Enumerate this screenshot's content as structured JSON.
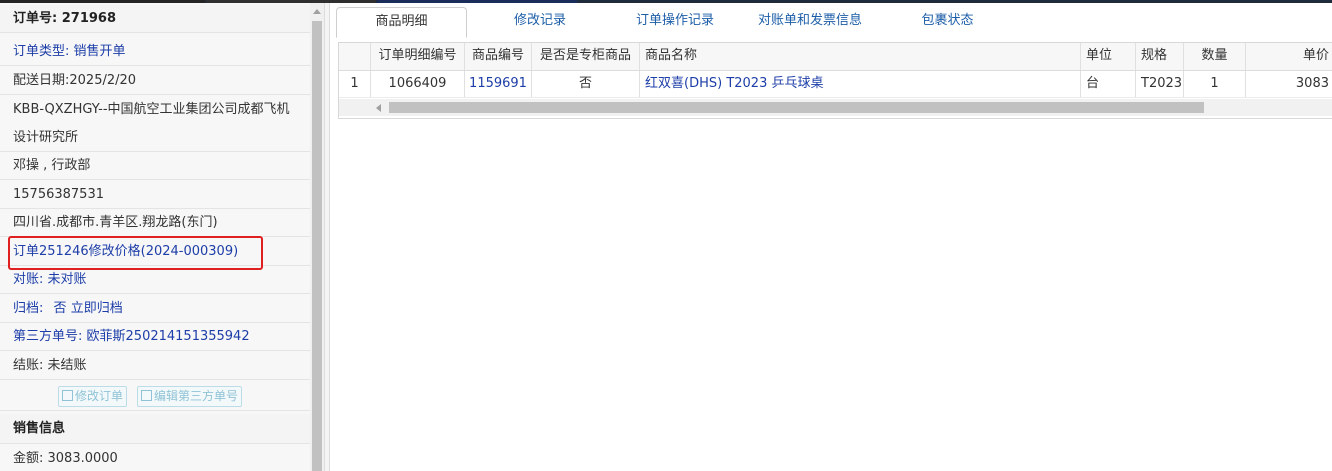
{
  "order": {
    "title_label": "订单号:",
    "title_value": "271968",
    "type_label": "订单类型:",
    "type_value": "销售开单",
    "delivery_date": "配送日期:2025/2/20",
    "company_line1": "KBB-QXZHGY--中国航空工业集团公司成都飞机",
    "company_line2": "设计研究所",
    "contact": "邓操 , 行政部",
    "phone": "15756387531",
    "address": "四川省.成都市.青羊区.翔龙路(东门)",
    "price_change_link": "订单251246修改价格(2024-000309)",
    "reconcile_label": "对账:",
    "reconcile_value": "未对账",
    "archive_label": "归档:",
    "archive_value": "否",
    "archive_link": "立即归档",
    "third_party_label": "第三方单号:",
    "third_party_value": "欧菲斯250214151355942",
    "settlement_label": "结账:",
    "settlement_value": "未结账",
    "edit_order_button": "修改订单",
    "edit_third_party_button": "编辑第三方单号"
  },
  "sales_info": {
    "header": "销售信息",
    "amount": "金额: 3083.0000"
  },
  "tabs": [
    {
      "label": "商品明细",
      "active": true
    },
    {
      "label": "修改记录",
      "active": false
    },
    {
      "label": "订单操作记录",
      "active": false
    },
    {
      "label": "对账单和发票信息",
      "active": false
    },
    {
      "label": "包裹状态",
      "active": false
    }
  ],
  "grid": {
    "columns": [
      "",
      "订单明细编号",
      "商品编号",
      "是否是专柜商品",
      "商品名称",
      "单位",
      "规格",
      "数量",
      "单价"
    ],
    "rows": [
      [
        "1",
        "1066409",
        "1159691",
        "否",
        "红双喜(DHS) T2023 乒乓球桌",
        "台",
        "T2023",
        "1",
        "3083"
      ]
    ]
  },
  "colors": {
    "link": "#1d3ea8",
    "tab_link": "#1d5ea8",
    "highlight_border": "#e02020"
  }
}
